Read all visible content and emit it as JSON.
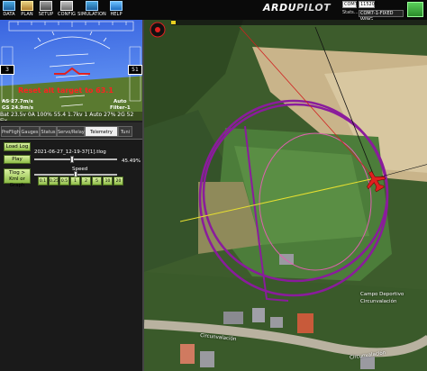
{
  "toolbar": {
    "items": [
      {
        "label": "DATA"
      },
      {
        "label": "PLAN"
      },
      {
        "label": "SETUP"
      },
      {
        "label": "CONFIG"
      },
      {
        "label": "SIMULATION"
      },
      {
        "label": "HELP"
      }
    ],
    "logo_main": "ARDU",
    "logo_sub": "PILOT",
    "port": "COM7",
    "baud": "115200",
    "stats_label": "Stats...",
    "connection_type": "COM7-1-FIXED WING"
  },
  "hud": {
    "airspeed": "3",
    "altitude": "51",
    "warning": "Reset alt target to 63.1",
    "airspeed_info": "AS 27.7m/s",
    "gs_info": "GS 24.9m/s",
    "mode_right": "Auto",
    "ekf_right": "Filter-1",
    "footer": "Bat 23.5v 0A 100% 55.4 1.7kv 1 Auto 27% 2G 52 Fix"
  },
  "tabs": [
    {
      "label": "PreFlight"
    },
    {
      "label": "Gauges"
    },
    {
      "label": "Status"
    },
    {
      "label": "Servo/Relay"
    },
    {
      "label": "Telemetry Logs"
    },
    {
      "label": "Tuni"
    }
  ],
  "telemetry": {
    "load_log": "Load Log",
    "filename": "2021-06-27_12-19-37[1].tlog",
    "play": "Play",
    "progress_text": "45.49%",
    "progress": 0.4549,
    "tlog_btn": "Tlog > Kml or Graph",
    "speed_label": "Speed",
    "speeds": [
      "0.1",
      "0.25",
      "0.5",
      "1",
      "2",
      "5",
      "10",
      "20"
    ]
  },
  "map": {
    "label_campo": "Campo Deportivo",
    "label_campo2": "Circunvalación",
    "label_road1": "Circunvalación",
    "label_road2": "Circunvalación"
  },
  "colors": {
    "loiter_circle": "#8a1c9c",
    "aircraft": "#e02020",
    "target_line": "#e8e030"
  }
}
